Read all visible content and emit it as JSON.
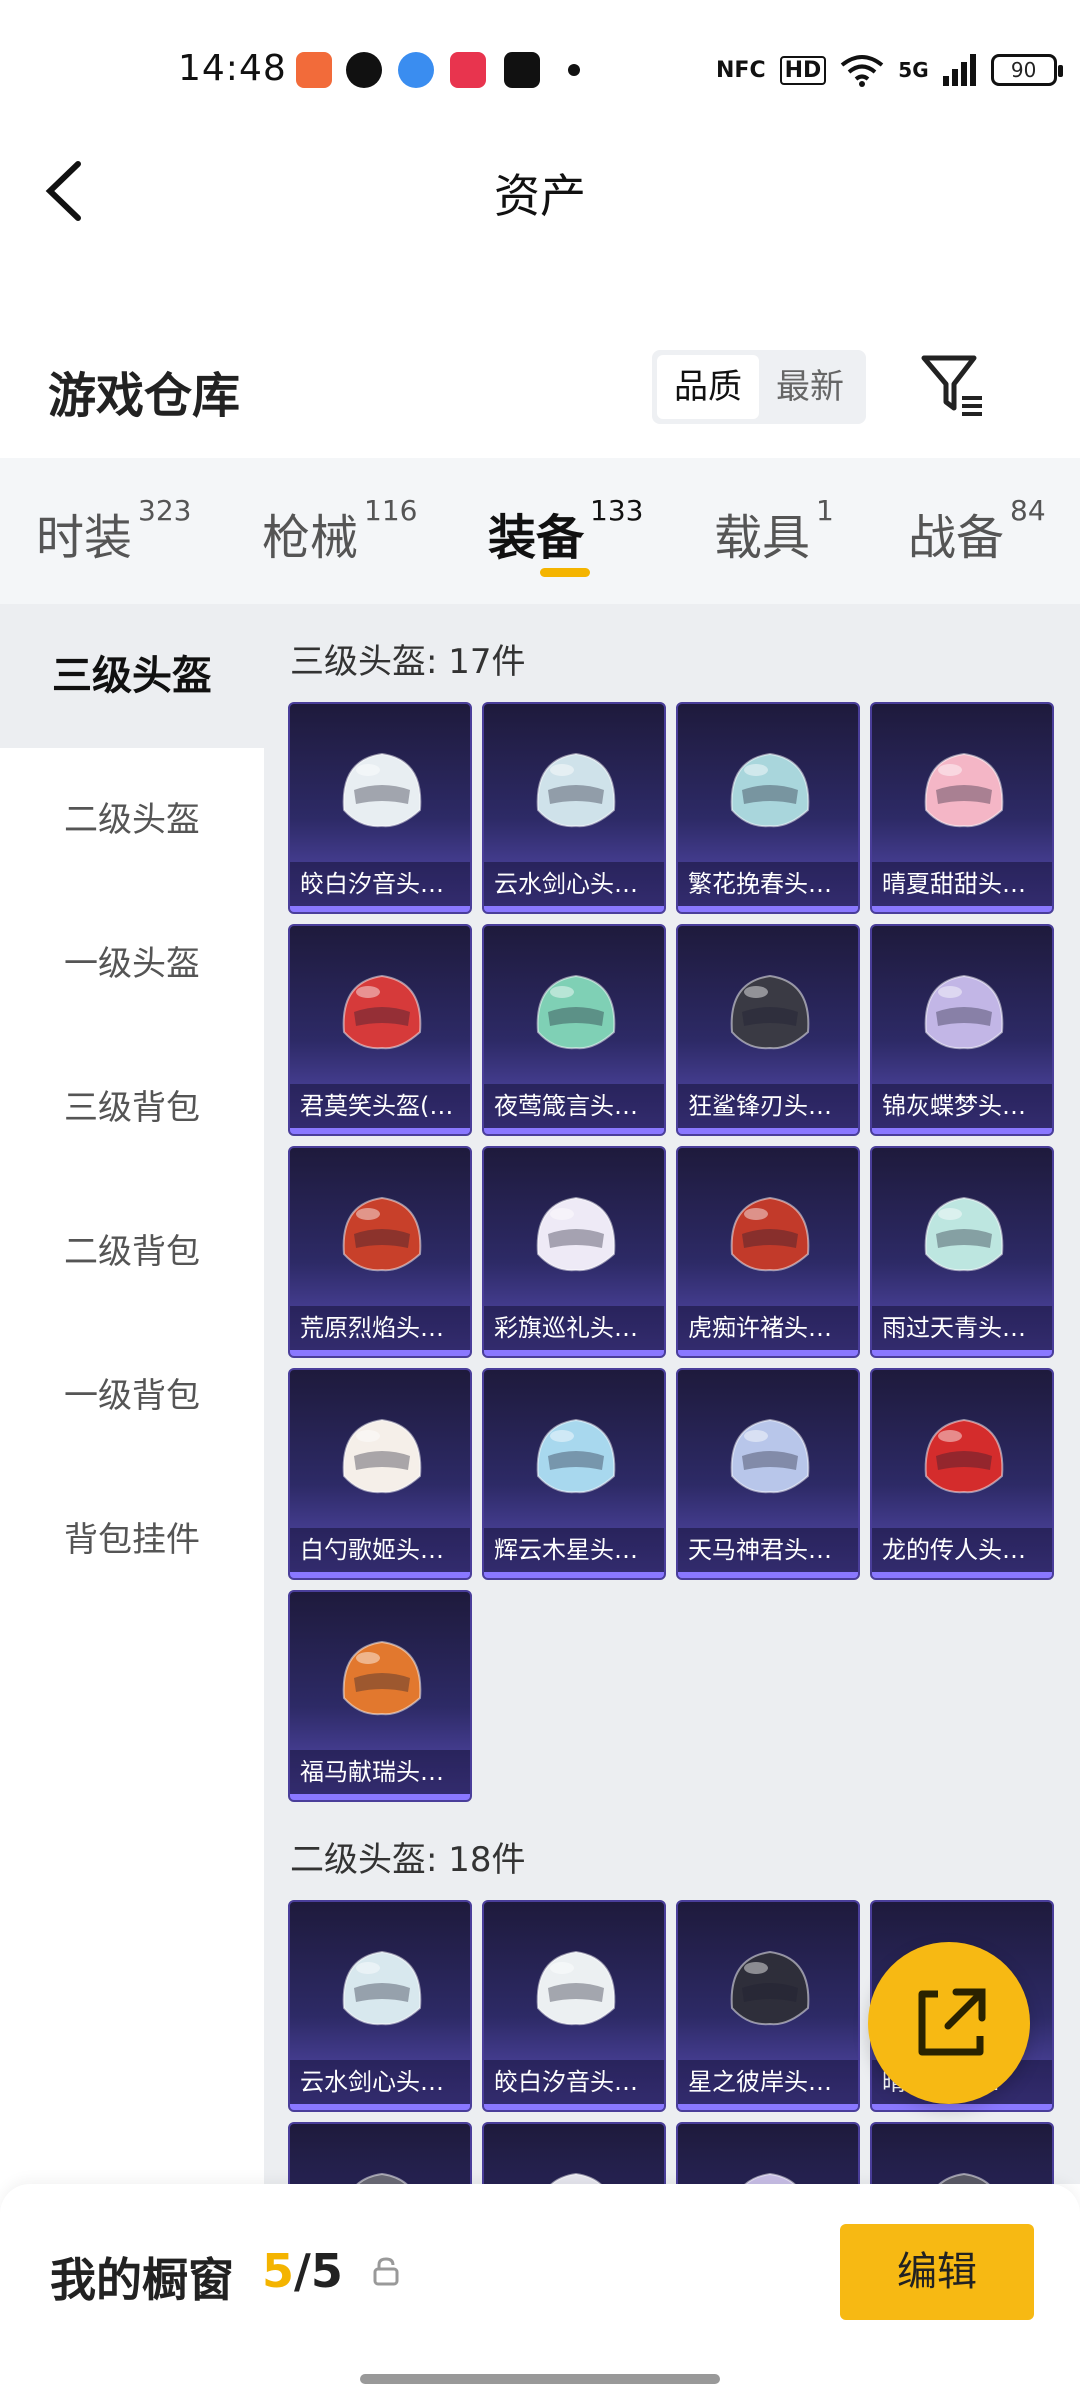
{
  "status_bar": {
    "time": "14:48",
    "app_icons": [
      {
        "name": "game-app-icon",
        "color": "#f26b3a"
      },
      {
        "name": "wechat-icon",
        "color": "#111111"
      },
      {
        "name": "browser-icon",
        "color": "#3a8df0"
      },
      {
        "name": "music-icon",
        "color": "#e8344e"
      },
      {
        "name": "douyin-icon",
        "color": "#111111"
      }
    ],
    "indicators": [
      "NFC",
      "HD",
      "5G"
    ],
    "battery": "90"
  },
  "header": {
    "title": "资产"
  },
  "warehouse": {
    "title": "游戏仓库",
    "sort_options": [
      "品质",
      "最新"
    ],
    "sort_active": 0
  },
  "category_tabs": [
    {
      "label": "时装",
      "count": "323"
    },
    {
      "label": "枪械",
      "count": "116"
    },
    {
      "label": "装备",
      "count": "133",
      "active": true
    },
    {
      "label": "载具",
      "count": "1"
    },
    {
      "label": "战备",
      "count": "84"
    }
  ],
  "sub_categories": [
    {
      "label": "三级头盔",
      "active": true
    },
    {
      "label": "二级头盔"
    },
    {
      "label": "一级头盔"
    },
    {
      "label": "三级背包"
    },
    {
      "label": "二级背包"
    },
    {
      "label": "一级背包"
    },
    {
      "label": "背包挂件"
    }
  ],
  "sections": [
    {
      "title": "三级头盔: 17件",
      "items": [
        {
          "label": "皎白汐音头盔...",
          "color": "#e8eef2"
        },
        {
          "label": "云水剑心头盔...",
          "color": "#cfe2ea"
        },
        {
          "label": "繁花挽春头盔...",
          "color": "#a9d6dc"
        },
        {
          "label": "晴夏甜甜头盔...",
          "color": "#f4b6c6"
        },
        {
          "label": "君莫笑头盔(3...",
          "color": "#d63a3a"
        },
        {
          "label": "夜莺箴言头盔...",
          "color": "#7fd0b5"
        },
        {
          "label": "狂鲨锋刃头盔...",
          "color": "#3a3a44"
        },
        {
          "label": "锦灰蝶梦头盔...",
          "color": "#c2b6e6"
        },
        {
          "label": "荒原烈焰头盔...",
          "color": "#c8402a"
        },
        {
          "label": "彩旗巡礼头盔...",
          "color": "#eeeaf6"
        },
        {
          "label": "虎痴许褚头盔...",
          "color": "#c23a2a"
        },
        {
          "label": "雨过天青头盔...",
          "color": "#bde6e0"
        },
        {
          "label": "白勺歌姬头盔...",
          "color": "#f5efe9"
        },
        {
          "label": "辉云木星头盔...",
          "color": "#a8d8ee"
        },
        {
          "label": "天马神君头盔...",
          "color": "#b8c6ea"
        },
        {
          "label": "龙的传人头盔...",
          "color": "#d42c2c"
        },
        {
          "label": "福马献瑞头盔...",
          "color": "#e2782e"
        }
      ]
    },
    {
      "title": "二级头盔: 18件",
      "items": [
        {
          "label": "云水剑心头盔...",
          "color": "#d8e8ee"
        },
        {
          "label": "皎白汐音头盔...",
          "color": "#ecf0f2"
        },
        {
          "label": "星之彼岸头盔...",
          "color": "#2e2e3a"
        },
        {
          "label": "晴...头盔...",
          "color": "#f0c0cc"
        },
        {
          "label": "",
          "color": "#6a6a76"
        },
        {
          "label": "",
          "color": "#e6e6ee"
        },
        {
          "label": "",
          "color": "#c8bee6"
        },
        {
          "label": "",
          "color": "#5a5a66"
        }
      ]
    }
  ],
  "bottom_bar": {
    "title": "我的橱窗",
    "count_current": "5",
    "count_sep": "/",
    "count_total": "5",
    "edit_label": "编辑"
  },
  "colors": {
    "accent": "#f4b400",
    "card_top": "#1e1a3c",
    "card_bottom": "#5b4fb8"
  }
}
